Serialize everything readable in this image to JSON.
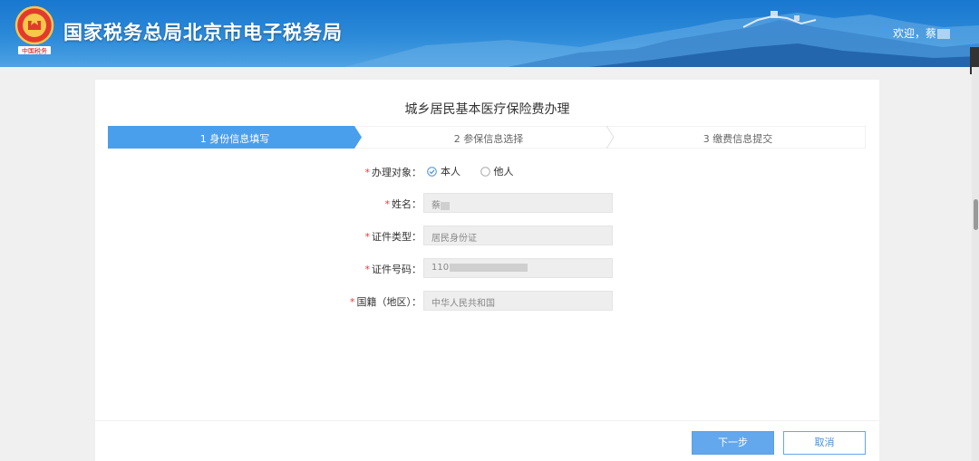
{
  "header": {
    "site_title": "国家税务总局北京市电子税务局",
    "welcome": "欢迎，蔡",
    "emblem_icon": "tax-emblem-icon",
    "colors": {
      "header_blue": "#1877cf",
      "accent": "#63a7ec",
      "required": "#e4393c"
    }
  },
  "page": {
    "title": "城乡居民基本医疗保险费办理"
  },
  "steps": [
    {
      "label": "1 身份信息填写",
      "active": true
    },
    {
      "label": "2 参保信息选择",
      "active": false
    },
    {
      "label": "3 缴费信息提交",
      "active": false
    }
  ],
  "form": {
    "target": {
      "label": "办理对象：",
      "options": [
        "本人",
        "他人"
      ],
      "selected": "本人"
    },
    "name": {
      "label": "姓名：",
      "value": "蔡"
    },
    "id_type": {
      "label": "证件类型：",
      "value": "居民身份证"
    },
    "id_number": {
      "label": "证件号码：",
      "value": "110"
    },
    "nationality": {
      "label": "国籍（地区）：",
      "value": "中华人民共和国"
    }
  },
  "actions": {
    "next_label": "下一步",
    "cancel_label": "取消"
  }
}
